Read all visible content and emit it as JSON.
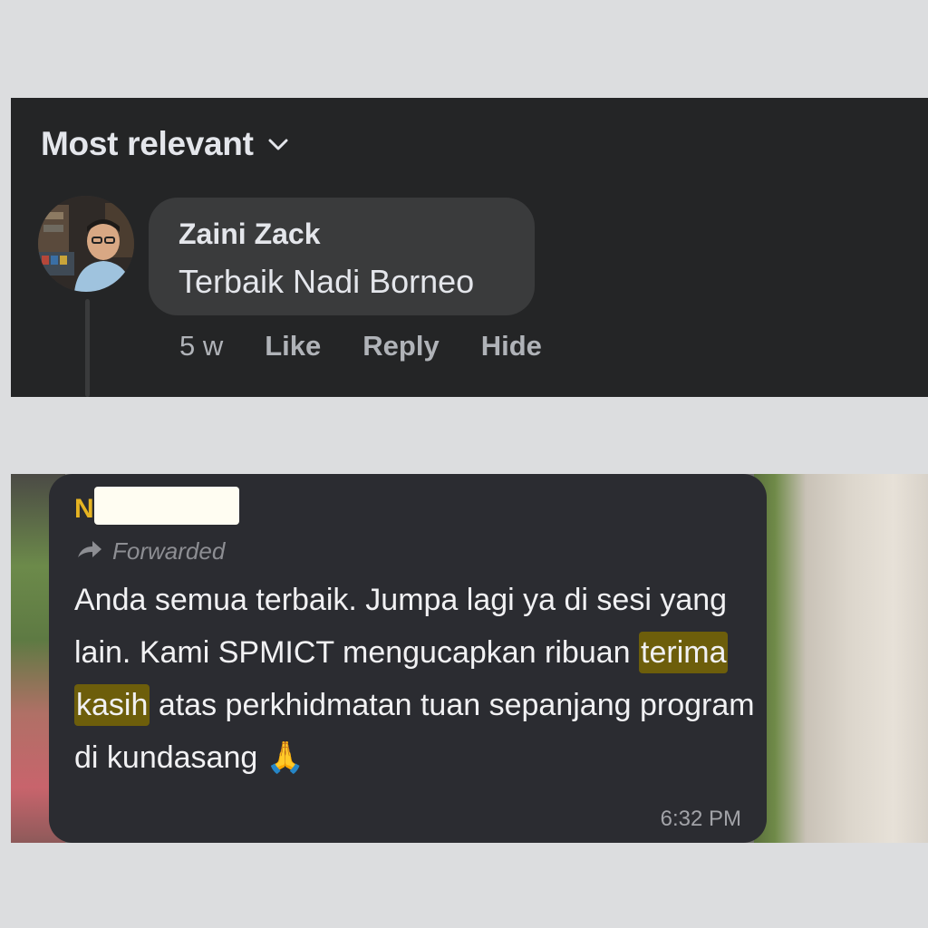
{
  "comments_panel": {
    "sort_label": "Most relevant",
    "comment": {
      "author": "Zaini Zack",
      "text": "Terbaik Nadi Borneo",
      "time": "5 w",
      "actions": {
        "like": "Like",
        "reply": "Reply",
        "hide": "Hide"
      }
    }
  },
  "chat_panel": {
    "sender_visible": "N",
    "forwarded_label": "Forwarded",
    "message": {
      "before_highlight": "Anda semua terbaik. Jumpa lagi ya di sesi yang lain. Kami SPMICT mengucapkan ribuan ",
      "highlight_1": "terima",
      "highlight_2": "kasih",
      "after_highlight": " atas perkhidmatan tuan sepanjang program di kundasang ",
      "emoji": "🙏"
    },
    "time": "6:32 PM"
  },
  "colors": {
    "fb_background": "#242526",
    "fb_bubble": "#3a3b3c",
    "tg_bubble": "#2b2c31",
    "sender_name": "#e6b422",
    "highlight": "#6d5e0b"
  }
}
